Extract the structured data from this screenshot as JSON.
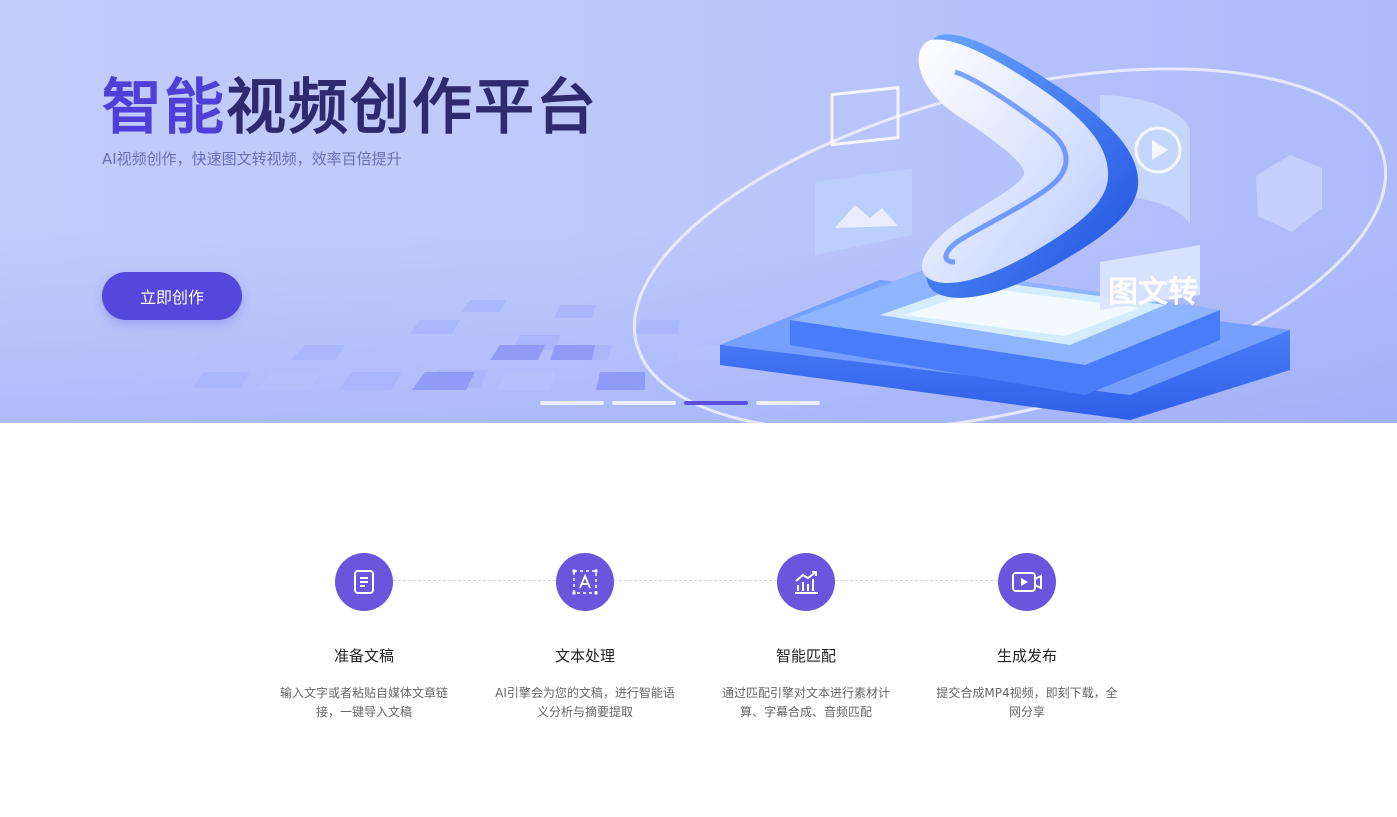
{
  "hero": {
    "title_accent": "智能",
    "title_rest": "视频创作平台",
    "subtitle": "AI视频创作，快速图文转视频，效率百倍提升",
    "cta_label": "立即创作",
    "illustration_text": "图文转",
    "slides": 4,
    "active_slide": 3
  },
  "steps": [
    {
      "icon": "document-icon",
      "title": "准备文稿",
      "desc": "输入文字或者粘贴自媒体文章链接，一键导入文稿"
    },
    {
      "icon": "text-a-icon",
      "title": "文本处理",
      "desc": "AI引擎会为您的文稿，进行智能语义分析与摘要提取"
    },
    {
      "icon": "chart-icon",
      "title": "智能匹配",
      "desc": "通过匹配引擎对文本进行素材计算、字幕合成、音频匹配"
    },
    {
      "icon": "video-play-icon",
      "title": "生成发布",
      "desc": "提交合成MP4视频，即刻下载，全网分享"
    }
  ],
  "colors": {
    "accent": "#5447dc",
    "step_circle": "#6a55dc",
    "title_dark": "#2e2a6e"
  }
}
